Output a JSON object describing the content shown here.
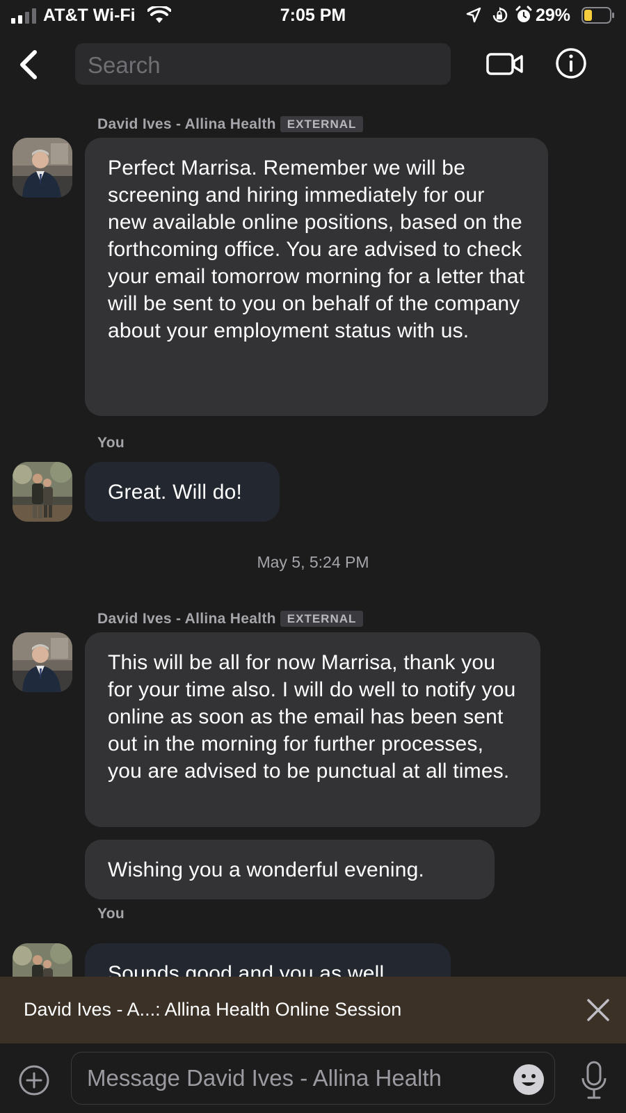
{
  "status_bar": {
    "carrier": "AT&T Wi-Fi",
    "time": "7:05 PM",
    "battery_percent": "29%"
  },
  "header": {
    "search_placeholder": "Search"
  },
  "messages": [
    {
      "sender": "David Ives - Allina Health",
      "badge": "EXTERNAL",
      "text": "Perfect Marrisa. Remember we will be screening and hiring immediately for our new available online positions, based on the forthcoming office. You are advised to check your email tomorrow morning for a letter that will be sent to you on behalf of the company about your employment status with us."
    },
    {
      "sender": "You",
      "text": "Great. Will do!"
    },
    {
      "sender": "David Ives - Allina Health",
      "badge": "EXTERNAL",
      "text": "This will be all for now Marrisa, thank you for your time also. I will do well to notify you online as soon as the email has been sent out in the morning for further processes, you are advised to be punctual at all times.",
      "text2": "Wishing you a wonderful evening."
    },
    {
      "sender": "You",
      "text": "Sounds good and you as well."
    }
  ],
  "date_separator": "May 5, 5:24 PM",
  "banner": {
    "text": "David Ives - A...: Allina Health Online Session"
  },
  "composer": {
    "placeholder": "Message David Ives - Allina Health"
  },
  "colors": {
    "background": "#1c1c1d",
    "incoming_bubble": "#333335",
    "outgoing_bubble": "#23272f",
    "banner": "#3b3127"
  }
}
